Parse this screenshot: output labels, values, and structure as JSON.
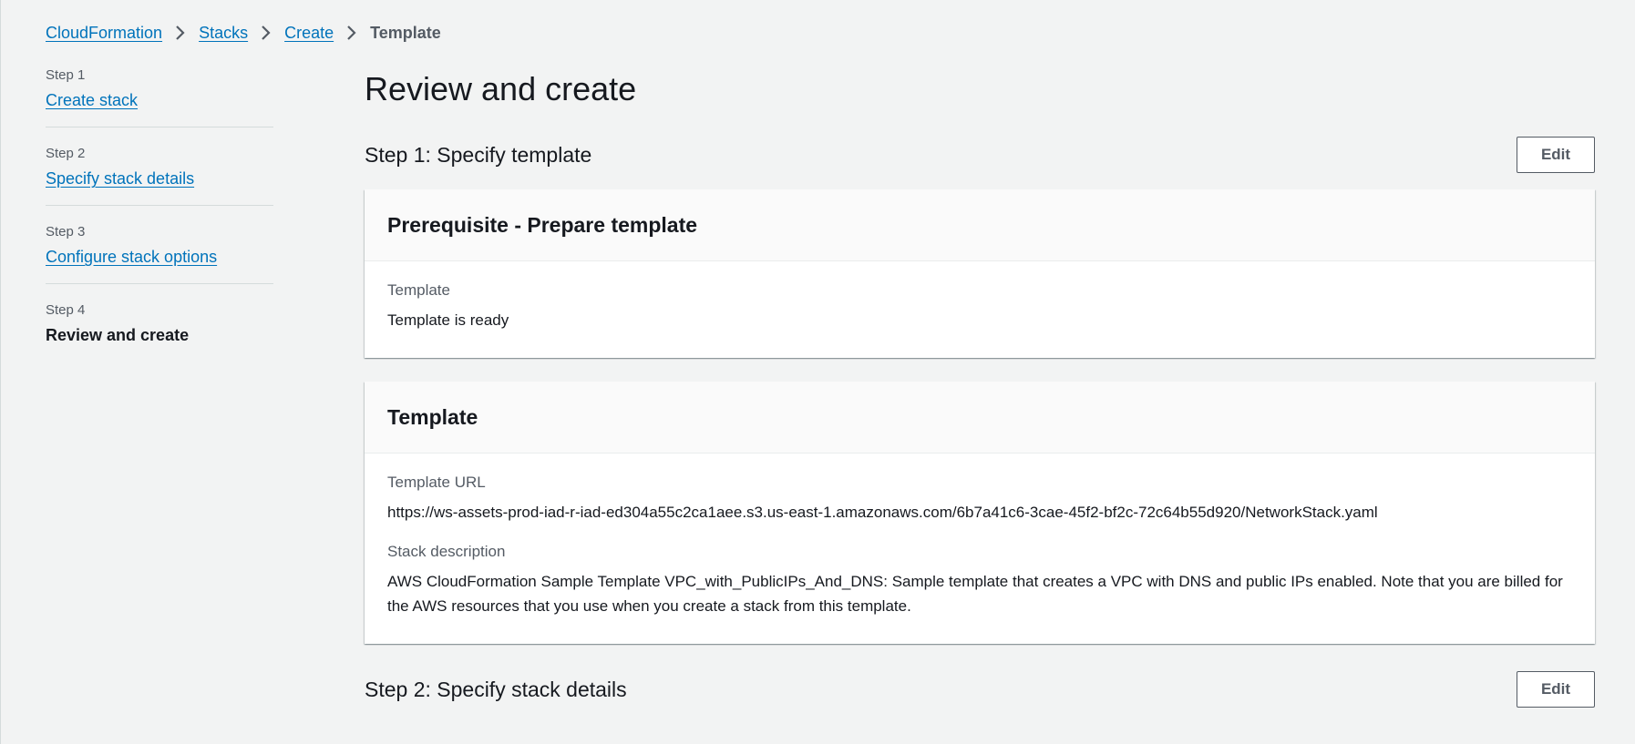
{
  "breadcrumb": {
    "items": [
      "CloudFormation",
      "Stacks",
      "Create"
    ],
    "current": "Template"
  },
  "steps": [
    {
      "num": "Step 1",
      "label": "Create stack"
    },
    {
      "num": "Step 2",
      "label": "Specify stack details"
    },
    {
      "num": "Step 3",
      "label": "Configure stack options"
    },
    {
      "num": "Step 4",
      "label": "Review and create"
    }
  ],
  "main": {
    "title": "Review and create",
    "section1": {
      "title": "Step 1: Specify template",
      "edit_label": "Edit",
      "prereq_card": {
        "title": "Prerequisite - Prepare template",
        "template_label": "Template",
        "template_value": "Template is ready"
      },
      "template_card": {
        "title": "Template",
        "url_label": "Template URL",
        "url_value": "https://ws-assets-prod-iad-r-iad-ed304a55c2ca1aee.s3.us-east-1.amazonaws.com/6b7a41c6-3cae-45f2-bf2c-72c64b55d920/NetworkStack.yaml",
        "desc_label": "Stack description",
        "desc_value": "AWS CloudFormation Sample Template VPC_with_PublicIPs_And_DNS: Sample template that creates a VPC with DNS and public IPs enabled. Note that you are billed for the AWS resources that you use when you create a stack from this template."
      }
    },
    "section2": {
      "title": "Step 2: Specify stack details",
      "edit_label": "Edit"
    }
  },
  "colors": {
    "link": "#0073bb",
    "text": "#16191f",
    "muted": "#545b64",
    "background": "#f2f3f3"
  }
}
